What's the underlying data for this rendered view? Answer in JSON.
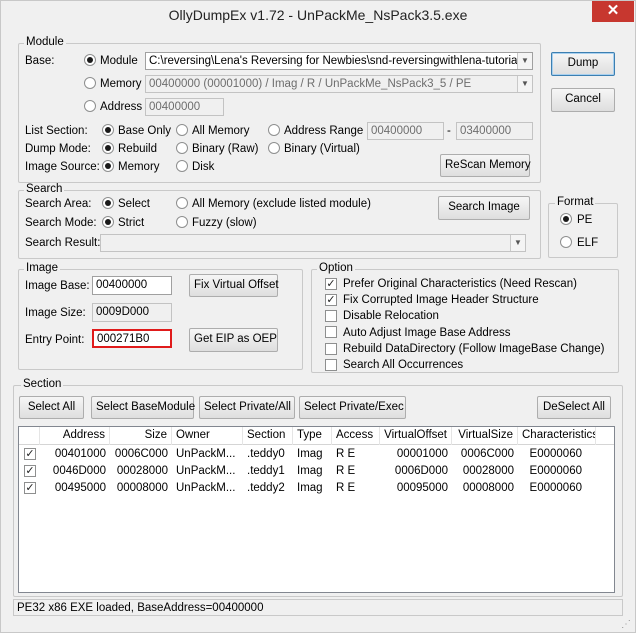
{
  "window": {
    "title": "OllyDumpEx v1.72 - UnPackMe_NsPack3.5.exe",
    "close": "✕"
  },
  "module": {
    "label": "Module",
    "base_label": "Base:",
    "module_radio": "Module",
    "module_path": "C:\\reversing\\Lena's Reversing for Newbies\\snd-reversingwithlena-tutorials\\sn",
    "memory_radio": "Memory",
    "memory_value": "00400000 (00001000) / Imag / R     / UnPackMe_NsPack3_5 / PE",
    "address_radio": "Address",
    "address_value": "00400000",
    "list_section_label": "List Section:",
    "base_only": "Base Only",
    "all_memory": "All Memory",
    "address_range": "Address Range",
    "range_from": "00400000",
    "range_dash": "-",
    "range_to": "03400000",
    "dump_mode_label": "Dump Mode:",
    "rebuild": "Rebuild",
    "binary_raw": "Binary (Raw)",
    "binary_virtual": "Binary (Virtual)",
    "image_source_label": "Image Source:",
    "memory_src": "Memory",
    "disk_src": "Disk",
    "rescan": "ReScan Memory"
  },
  "search": {
    "label": "Search",
    "area_label": "Search Area:",
    "select": "Select",
    "all_memory_excl": "All Memory (exclude listed module)",
    "mode_label": "Search Mode:",
    "strict": "Strict",
    "fuzzy": "Fuzzy (slow)",
    "result_label": "Search Result:",
    "search_image": "Search Image"
  },
  "actions": {
    "dump": "Dump",
    "cancel": "Cancel"
  },
  "format": {
    "label": "Format",
    "pe": "PE",
    "elf": "ELF"
  },
  "image": {
    "label": "Image",
    "base_label": "Image Base:",
    "base_value": "00400000",
    "size_label": "Image Size:",
    "size_value": "0009D000",
    "entry_label": "Entry Point:",
    "entry_value": "000271B0",
    "fix_virtual_offset": "Fix Virtual Offset",
    "get_eip": "Get EIP as OEP"
  },
  "option": {
    "label": "Option",
    "items": [
      {
        "label": "Prefer Original Characteristics (Need Rescan)",
        "checked": true
      },
      {
        "label": "Fix Corrupted Image Header Structure",
        "checked": true
      },
      {
        "label": "Disable Relocation",
        "checked": false
      },
      {
        "label": "Auto Adjust Image Base Address",
        "checked": false
      },
      {
        "label": "Rebuild DataDirectory (Follow ImageBase Change)",
        "checked": false
      },
      {
        "label": "Search All Occurrences",
        "checked": false
      }
    ]
  },
  "section": {
    "label": "Section",
    "buttons": [
      "Select All",
      "Select BaseModule",
      "Select Private/All",
      "Select Private/Exec",
      "DeSelect All"
    ],
    "columns": [
      "Address",
      "Size",
      "Owner",
      "Section",
      "Type",
      "Access",
      "VirtualOffset",
      "VirtualSize",
      "Characteristics"
    ],
    "rows": [
      {
        "checked": true,
        "cells": [
          "00401000",
          "0006C000",
          "UnPackM...",
          ".teddy0",
          "Imag",
          "R E",
          "00001000",
          "0006C000",
          "E0000060"
        ]
      },
      {
        "checked": true,
        "cells": [
          "0046D000",
          "00028000",
          "UnPackM...",
          ".teddy1",
          "Imag",
          "R E",
          "0006D000",
          "00028000",
          "E0000060"
        ]
      },
      {
        "checked": true,
        "cells": [
          "00495000",
          "00008000",
          "UnPackM...",
          ".teddy2",
          "Imag",
          "R E",
          "00095000",
          "00008000",
          "E0000060"
        ]
      }
    ]
  },
  "status": {
    "text": "PE32 x86 EXE loaded, BaseAddress=00400000"
  },
  "colors": {
    "entry_highlight": "#e01b1b",
    "close_button": "#c7372f"
  }
}
